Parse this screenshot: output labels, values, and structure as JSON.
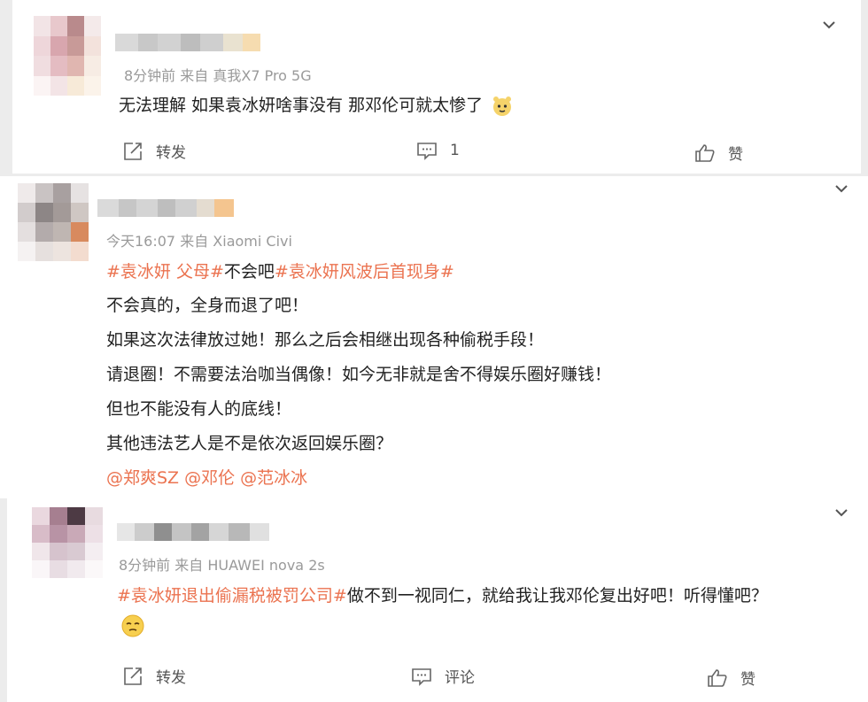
{
  "post1": {
    "meta": "8分钟前  来自 真我X7 Pro 5G",
    "text": "无法理解 如果袁冰妍啥事没有 那邓伦可就太惨了",
    "actions": {
      "repost": "转发",
      "comment": "1",
      "like": "赞"
    }
  },
  "post2": {
    "meta": "今天16:07  来自 Xiaomi Civi",
    "tag1": "#袁冰妍 父母#",
    "mid": "不会吧",
    "tag2": "#袁冰妍风波后首现身#",
    "lines": [
      "不会真的，全身而退了吧！",
      "如果这次法律放过她！那么之后会相继出现各种偷税手段！",
      "请退圈！不需要法治咖当偶像！如今无非就是舍不得娱乐圈好赚钱！",
      "但也不能没有人的底线！",
      "其他违法艺人是不是依次返回娱乐圈？"
    ],
    "mentions": "@郑爽SZ @邓伦 @范冰冰"
  },
  "post3": {
    "meta": "8分钟前  来自 HUAWEI nova 2s",
    "tag": "#袁冰妍退出偷漏税被罚公司#",
    "text": "做不到一视同仁，就给我让我邓伦复出好吧！听得懂吧？",
    "actions": {
      "repost": "转发",
      "comment": "评论",
      "like": "赞"
    }
  },
  "colors": {
    "accent": "#eb7350",
    "meta": "#9a9a9a"
  },
  "icons": [
    "chevron-down-icon",
    "repost-icon",
    "comment-icon",
    "like-icon",
    "emoji-icon"
  ]
}
